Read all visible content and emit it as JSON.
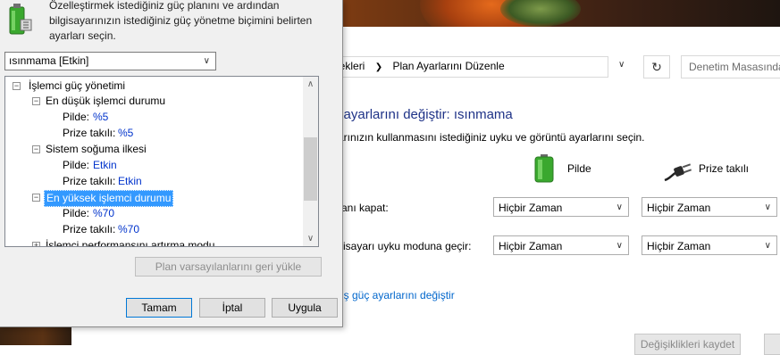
{
  "control_panel": {
    "breadcrumb": [
      "nekleri",
      "Plan Ayarlarını Düzenle"
    ],
    "search_placeholder": "Denetim Masasında",
    "heading": "n ayarlarını değiştir: ısınmama",
    "description": "yarınızın kullanmasını istediğiniz uyku ve görüntü ayarlarını seçin.",
    "column_battery": "Pilde",
    "column_plugged": "Prize takılı",
    "rows": [
      {
        "label": "kranı kapat:",
        "battery": "Hiçbir Zaman",
        "plugged": "Hiçbir Zaman"
      },
      {
        "label": "ilgisayarı uyku moduna geçir:",
        "battery": "Hiçbir Zaman",
        "plugged": "Hiçbir Zaman"
      }
    ],
    "advanced_link": "miş güç ayarlarını değiştir",
    "save_button": "Değişiklikleri kaydet"
  },
  "dialog": {
    "intro_text": "Özelleştirmek istediğiniz güç planını ve ardından bilgisayarınızın istediğiniz güç yönetme biçimini belirten ayarları seçin.",
    "plan_select": "ısınmama [Etkin]",
    "tree": {
      "root": "İşlemci güç yönetimi",
      "min_state": "En düşük işlemci durumu",
      "min_battery_label": "Pilde:",
      "min_battery_value": "%5",
      "min_plugged_label": "Prize takılı:",
      "min_plugged_value": "%5",
      "cooling": "Sistem soğuma ilkesi",
      "cooling_battery_label": "Pilde:",
      "cooling_battery_value": "Etkin",
      "cooling_plugged_label": "Prize takılı:",
      "cooling_plugged_value": "Etkin",
      "max_state": "En yüksek işlemci durumu",
      "max_battery_label": "Pilde:",
      "max_battery_value": "%70",
      "max_plugged_label": "Prize takılı:",
      "max_plugged_value": "%70",
      "boost_mode": "İşlemci performansını artırma modu"
    },
    "restore_defaults_button": "Plan varsayılanlarını geri yükle",
    "ok_button": "Tamam",
    "cancel_button": "İptal",
    "apply_button": "Uygula"
  }
}
